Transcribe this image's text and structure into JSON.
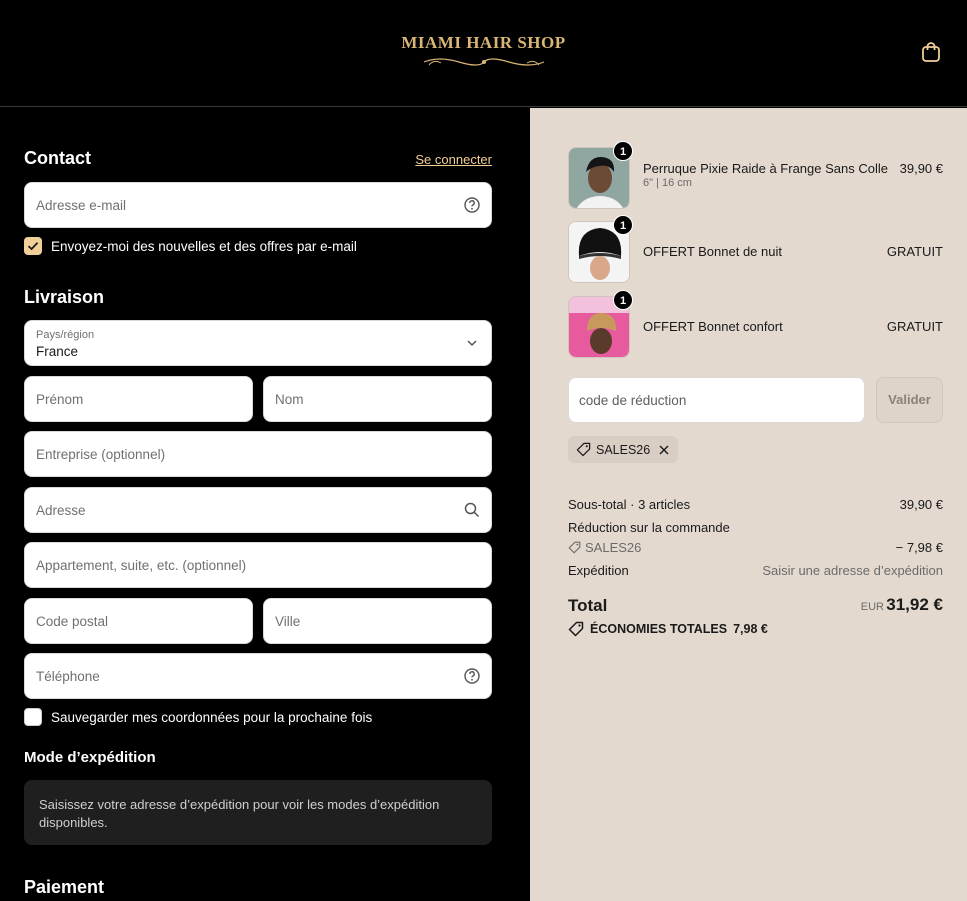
{
  "header": {
    "shop_name": "MIAMI HAIR SHOP",
    "cart_icon": "shopping-bag-icon"
  },
  "contact": {
    "title": "Contact",
    "login_link": "Se connecter",
    "email_placeholder": "Adresse e-mail",
    "newsletter_label": "Envoyez-moi des nouvelles et des offres par e-mail",
    "newsletter_checked": true
  },
  "delivery": {
    "title": "Livraison",
    "country_label": "Pays/région",
    "country_value": "France",
    "first_name_placeholder": "Prénom",
    "last_name_placeholder": "Nom",
    "company_placeholder": "Entreprise (optionnel)",
    "address_placeholder": "Adresse",
    "apartment_placeholder": "Appartement, suite, etc. (optionnel)",
    "postal_placeholder": "Code postal",
    "city_placeholder": "Ville",
    "phone_placeholder": "Téléphone",
    "save_info_label": "Sauvegarder mes coordonnées pour la prochaine fois",
    "save_info_checked": false
  },
  "shipping_method": {
    "title": "Mode d’expédition",
    "info": "Saisissez votre adresse d’expédition pour voir les modes d’expédition disponibles."
  },
  "payment": {
    "title": "Paiement"
  },
  "order": {
    "items": [
      {
        "name": "Perruque Pixie Raide à Frange Sans Colle",
        "variant": "6\" | 16 cm",
        "price": "39,90 €",
        "qty": "1"
      },
      {
        "name": "OFFERT Bonnet de nuit",
        "variant": "",
        "price": "GRATUIT",
        "qty": "1"
      },
      {
        "name": "OFFERT Bonnet confort",
        "variant": "",
        "price": "GRATUIT",
        "qty": "1"
      }
    ],
    "discount_placeholder": "code de réduction",
    "apply_label": "Valider",
    "applied_code": "SALES26",
    "subtotal_label": "Sous-total · 3 articles",
    "subtotal_value": "39,90 €",
    "discount_label": "Réduction sur la commande",
    "discount_code": "SALES26",
    "discount_value": "− 7,98 €",
    "shipping_label": "Expédition",
    "shipping_value": "Saisir une adresse d’expédition",
    "total_label": "Total",
    "currency": "EUR",
    "total_value": "31,92 €",
    "savings_label": "ÉCONOMIES TOTALES",
    "savings_value": "7,98 €"
  },
  "colors": {
    "accent": "#f1cf98",
    "logo_gold": "#d9b676",
    "summary_bg": "#e3d9cf"
  }
}
